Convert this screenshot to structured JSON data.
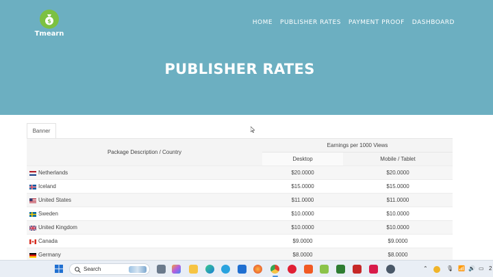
{
  "brand": {
    "name": "Tmearn",
    "logo_color": "#7cc142"
  },
  "nav": [
    {
      "label": "HOME"
    },
    {
      "label": "PUBLISHER RATES"
    },
    {
      "label": "PAYMENT PROOF"
    },
    {
      "label": "DASHBOARD"
    }
  ],
  "hero": {
    "title": "PUBLISHER RATES",
    "background": "#6cafc1"
  },
  "tabs": [
    {
      "label": "Banner"
    }
  ],
  "table": {
    "col_description": "Package Description / Country",
    "col_group": "Earnings per 1000 Views",
    "col_desktop": "Desktop",
    "col_mobile": "Mobile / Tablet",
    "rows": [
      {
        "country": "Netherlands",
        "flag": "netherlands-flag-icon",
        "desktop": "$20.0000",
        "mobile": "$20.0000"
      },
      {
        "country": "Iceland",
        "flag": "iceland-flag-icon",
        "desktop": "$15.0000",
        "mobile": "$15.0000"
      },
      {
        "country": "United States",
        "flag": "united-states-flag-icon",
        "desktop": "$11.0000",
        "mobile": "$11.0000"
      },
      {
        "country": "Sweden",
        "flag": "sweden-flag-icon",
        "desktop": "$10.0000",
        "mobile": "$10.0000"
      },
      {
        "country": "United Kingdom",
        "flag": "united-kingdom-flag-icon",
        "desktop": "$10.0000",
        "mobile": "$10.0000"
      },
      {
        "country": "Canada",
        "flag": "canada-flag-icon",
        "desktop": "$9.0000",
        "mobile": "$9.0000"
      },
      {
        "country": "Germany",
        "flag": "germany-flag-icon",
        "desktop": "$8.0000",
        "mobile": "$8.0000"
      }
    ]
  },
  "taskbar": {
    "search_placeholder": "Search",
    "tray_text": "2"
  }
}
